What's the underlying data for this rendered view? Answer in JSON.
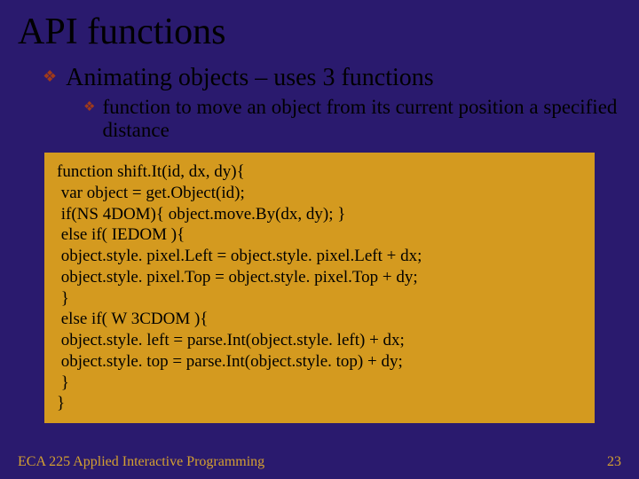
{
  "slide": {
    "title": "API functions",
    "bullet1": "Animating objects – uses 3 functions",
    "bullet2": "function to move an object from its current position a specified distance",
    "code": {
      "l1": "function shift.It(id, dx, dy){",
      "l2": " var object = get.Object(id);",
      "l3": " if(NS 4DOM){ object.move.By(dx, dy); }",
      "l4": " else if( IEDOM ){",
      "l5": " object.style. pixel.Left = object.style. pixel.Left + dx;",
      "l6": " object.style. pixel.Top = object.style. pixel.Top + dy;",
      "l7": " }",
      "l8": " else if( W 3CDOM ){",
      "l9": " object.style. left = parse.Int(object.style. left) + dx;",
      "l10": " object.style. top = parse.Int(object.style. top) + dy;",
      "l11": " }",
      "l12": "}"
    },
    "footer_left": "ECA 225   Applied Interactive Programming",
    "footer_right": "23"
  }
}
